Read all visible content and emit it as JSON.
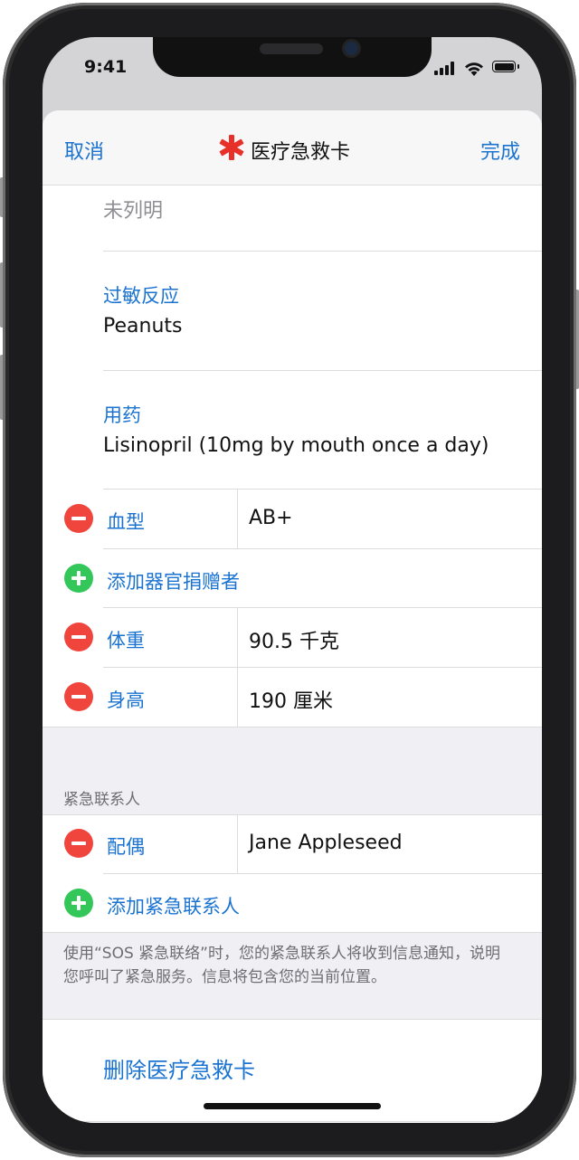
{
  "status_bar": {
    "time": "9:41"
  },
  "nav": {
    "cancel_label": "取消",
    "title": "医疗急救卡",
    "done_label": "完成"
  },
  "medical": {
    "unlisted_value": "未列明",
    "allergies_label": "过敏反应",
    "allergies_value": "Peanuts",
    "medications_label": "用药",
    "medications_value": "Lisinopril (10mg by mouth once a day)",
    "rows": [
      {
        "label": "血型",
        "value": "AB+"
      },
      {
        "label": "体重",
        "value": "90.5 千克"
      },
      {
        "label": "身高",
        "value": "190 厘米"
      }
    ],
    "add_organ_donor": "添加器官捐赠者"
  },
  "emergency": {
    "header": "紧急联系人",
    "contact": {
      "label": "配偶",
      "value": "Jane Appleseed"
    },
    "add_contact": "添加紧急联系人",
    "footer": "使用“SOS 紧急联络”时，您的紧急联系人将收到信息通知，说明您呼叫了紧急服务。信息将包含您的当前位置。"
  },
  "delete_label": "删除医疗急救卡",
  "colors": {
    "accent": "#1a73d1",
    "remove": "#f0453c",
    "add": "#33c659",
    "star": "#e8302a"
  },
  "icons": [
    "star-of-life-icon",
    "remove-circle-icon",
    "add-circle-icon",
    "signal-icon",
    "wifi-icon",
    "battery-icon"
  ]
}
